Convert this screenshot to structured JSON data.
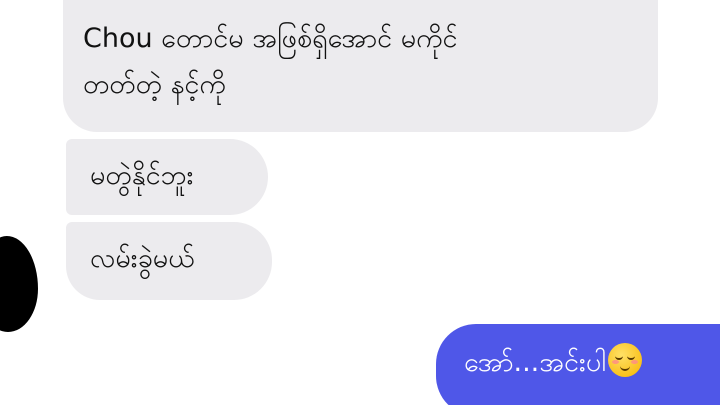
{
  "messages": {
    "incoming": [
      {
        "lines": [
          "Chou တောင်မ အဖြစ်ရှိအောင် မကိုင်",
          "တတ်တဲ့ နင့်ကို"
        ]
      },
      {
        "lines": [
          "မတွဲနိုင်ဘူး"
        ]
      },
      {
        "lines": [
          "လမ်းခွဲမယ်"
        ]
      }
    ],
    "outgoing": [
      {
        "text": "အော်...အင်းပါ",
        "emoji": "relieved-face-icon"
      }
    ]
  },
  "colors": {
    "incoming_bubble": "#ecebee",
    "outgoing_bubble": "#4f57e8",
    "outgoing_text": "#ffffff"
  }
}
